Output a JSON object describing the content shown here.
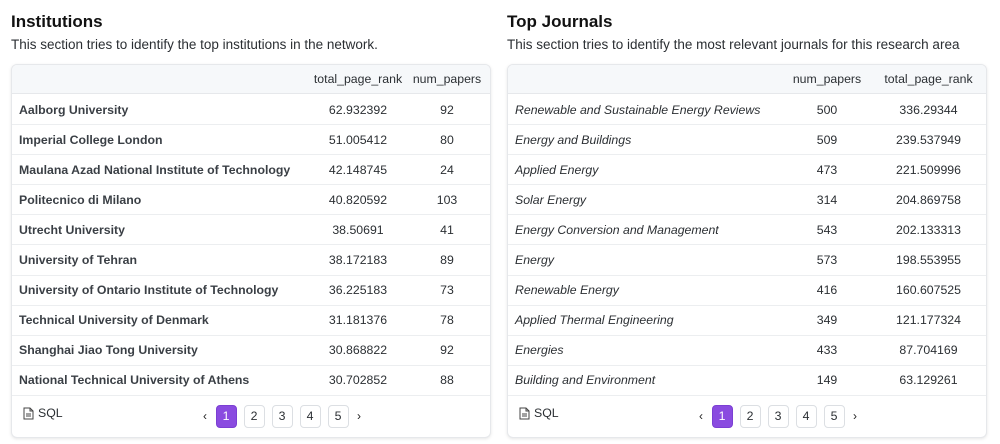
{
  "institutions": {
    "title": "Institutions",
    "description": "This section tries to identify the top institutions in the network.",
    "columns": [
      "total_page_rank",
      "num_papers"
    ],
    "rows": [
      {
        "name": "Aalborg University",
        "total_page_rank": "62.932392",
        "num_papers": "92"
      },
      {
        "name": "Imperial College London",
        "total_page_rank": "51.005412",
        "num_papers": "80"
      },
      {
        "name": "Maulana Azad National Institute of Technology",
        "total_page_rank": "42.148745",
        "num_papers": "24"
      },
      {
        "name": "Politecnico di Milano",
        "total_page_rank": "40.820592",
        "num_papers": "103"
      },
      {
        "name": "Utrecht University",
        "total_page_rank": "38.50691",
        "num_papers": "41"
      },
      {
        "name": "University of Tehran",
        "total_page_rank": "38.172183",
        "num_papers": "89"
      },
      {
        "name": "University of Ontario Institute of Technology",
        "total_page_rank": "36.225183",
        "num_papers": "73"
      },
      {
        "name": "Technical University of Denmark",
        "total_page_rank": "31.181376",
        "num_papers": "78"
      },
      {
        "name": "Shanghai Jiao Tong University",
        "total_page_rank": "30.868822",
        "num_papers": "92"
      },
      {
        "name": "National Technical University of Athens",
        "total_page_rank": "30.702852",
        "num_papers": "88"
      }
    ],
    "sql_label": "SQL",
    "pagination": {
      "prev": "‹",
      "next": "›",
      "pages": [
        "1",
        "2",
        "3",
        "4",
        "5"
      ],
      "current": "1"
    }
  },
  "journals": {
    "title": "Top Journals",
    "description": "This section tries to identify the most relevant journals for this research area",
    "columns": [
      "num_papers",
      "total_page_rank"
    ],
    "rows": [
      {
        "name": "Renewable and Sustainable Energy Reviews",
        "num_papers": "500",
        "total_page_rank": "336.29344"
      },
      {
        "name": "Energy and Buildings",
        "num_papers": "509",
        "total_page_rank": "239.537949"
      },
      {
        "name": "Applied Energy",
        "num_papers": "473",
        "total_page_rank": "221.509996"
      },
      {
        "name": "Solar Energy",
        "num_papers": "314",
        "total_page_rank": "204.869758"
      },
      {
        "name": "Energy Conversion and Management",
        "num_papers": "543",
        "total_page_rank": "202.133313"
      },
      {
        "name": "Energy",
        "num_papers": "573",
        "total_page_rank": "198.553955"
      },
      {
        "name": "Renewable Energy",
        "num_papers": "416",
        "total_page_rank": "160.607525"
      },
      {
        "name": "Applied Thermal Engineering",
        "num_papers": "349",
        "total_page_rank": "121.177324"
      },
      {
        "name": "Energies",
        "num_papers": "433",
        "total_page_rank": "87.704169"
      },
      {
        "name": "Building and Environment",
        "num_papers": "149",
        "total_page_rank": "63.129261"
      }
    ],
    "sql_label": "SQL",
    "pagination": {
      "prev": "‹",
      "next": "›",
      "pages": [
        "1",
        "2",
        "3",
        "4",
        "5"
      ],
      "current": "1"
    }
  },
  "icons": {
    "sql": "file-icon",
    "prev": "chevron-left-icon",
    "next": "chevron-right-icon"
  },
  "colors": {
    "active_page": "#8a4be0",
    "header_bg": "#f6f8fa",
    "border": "#e6e8eb"
  }
}
